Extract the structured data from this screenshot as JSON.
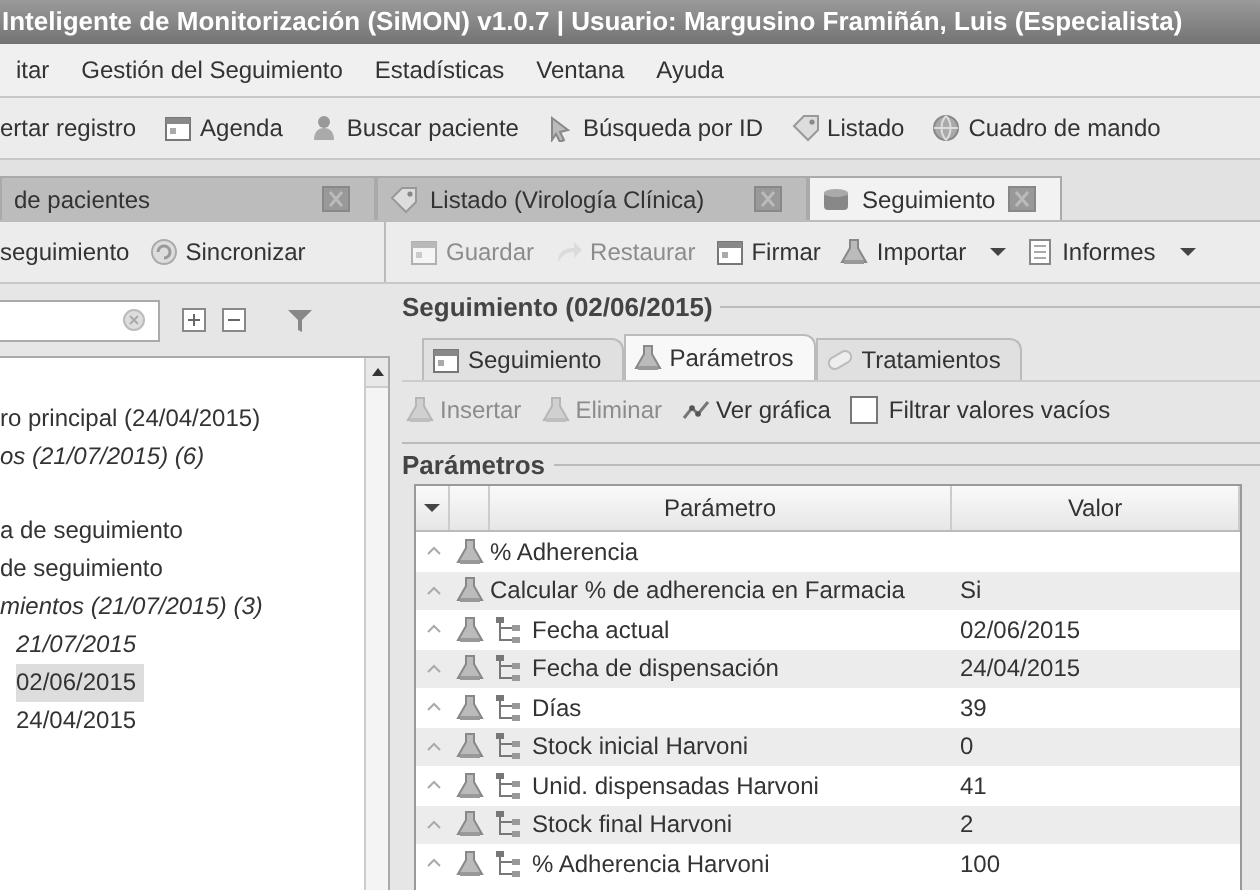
{
  "window": {
    "title": "Inteligente de Monitorización (SiMON) v1.0.7 | Usuario: Margusino Framiñán, Luis (Especialista)"
  },
  "menu": [
    "itar",
    "Gestión del Seguimiento",
    "Estadísticas",
    "Ventana",
    "Ayuda"
  ],
  "toolbar": [
    "ertar registro",
    "Agenda",
    "Buscar paciente",
    "Búsqueda por ID",
    "Listado",
    "Cuadro de mando"
  ],
  "document_tabs": [
    {
      "label": "de pacientes",
      "selected": false
    },
    {
      "label": "Listado (Virología Clínica)",
      "selected": false
    },
    {
      "label": "Seguimiento",
      "selected": true
    }
  ],
  "left_toolbar": [
    "seguimiento",
    "Sincronizar"
  ],
  "actions": [
    {
      "label": "Guardar",
      "disabled": true,
      "dropdown": false
    },
    {
      "label": "Restaurar",
      "disabled": true,
      "dropdown": false
    },
    {
      "label": "Firmar",
      "disabled": false,
      "dropdown": false
    },
    {
      "label": "Importar",
      "disabled": false,
      "dropdown": true
    },
    {
      "label": "Informes",
      "disabled": false,
      "dropdown": true
    }
  ],
  "tree": [
    {
      "label": "ro principal (24/04/2015)",
      "italic": false,
      "selected": false
    },
    {
      "label": "os (21/07/2015) (6)",
      "italic": true,
      "selected": false
    },
    {
      "label": "a de seguimiento",
      "italic": false,
      "selected": false
    },
    {
      "label": "de seguimiento",
      "italic": false,
      "selected": false
    },
    {
      "label": "mientos (21/07/2015) (3)",
      "italic": true,
      "selected": false,
      "children": [
        {
          "label": "21/07/2015",
          "italic": true,
          "selected": false
        },
        {
          "label": "02/06/2015",
          "italic": false,
          "selected": true
        },
        {
          "label": "24/04/2015",
          "italic": false,
          "selected": false
        }
      ]
    }
  ],
  "detail": {
    "title": "Seguimiento (02/06/2015)",
    "tabs": [
      {
        "label": "Seguimiento",
        "selected": false
      },
      {
        "label": "Parámetros",
        "selected": true
      },
      {
        "label": "Tratamientos",
        "selected": false
      }
    ],
    "tools": [
      {
        "kind": "button",
        "label": "Insertar",
        "disabled": true
      },
      {
        "kind": "button",
        "label": "Eliminar",
        "disabled": true
      },
      {
        "kind": "button",
        "label": "Ver gráfica",
        "disabled": false
      },
      {
        "kind": "checkbox",
        "label": "Filtrar valores vacíos",
        "checked": false
      }
    ],
    "group_title": "Parámetros",
    "table": {
      "columns": [
        "Parámetro",
        "Valor"
      ],
      "rows": [
        {
          "kind": "root",
          "parameter": "% Adherencia"
        },
        {
          "kind": "root",
          "parameter": "Calcular % de adherencia en Farmacia",
          "value": "Si"
        },
        {
          "kind": "derived",
          "parameter": "Fecha actual",
          "value": "02/06/2015"
        },
        {
          "kind": "derived",
          "parameter": "Fecha de dispensación",
          "value": "24/04/2015"
        },
        {
          "kind": "derived",
          "parameter": "Días",
          "value": "39"
        },
        {
          "kind": "derived",
          "parameter": "Stock inicial Harvoni",
          "value": "0"
        },
        {
          "kind": "derived",
          "parameter": "Unid. dispensadas Harvoni",
          "value": "41"
        },
        {
          "kind": "derived",
          "parameter": "Stock final Harvoni",
          "value": "2"
        },
        {
          "kind": "derived",
          "parameter": "% Adherencia Harvoni",
          "value": "100"
        }
      ]
    }
  }
}
